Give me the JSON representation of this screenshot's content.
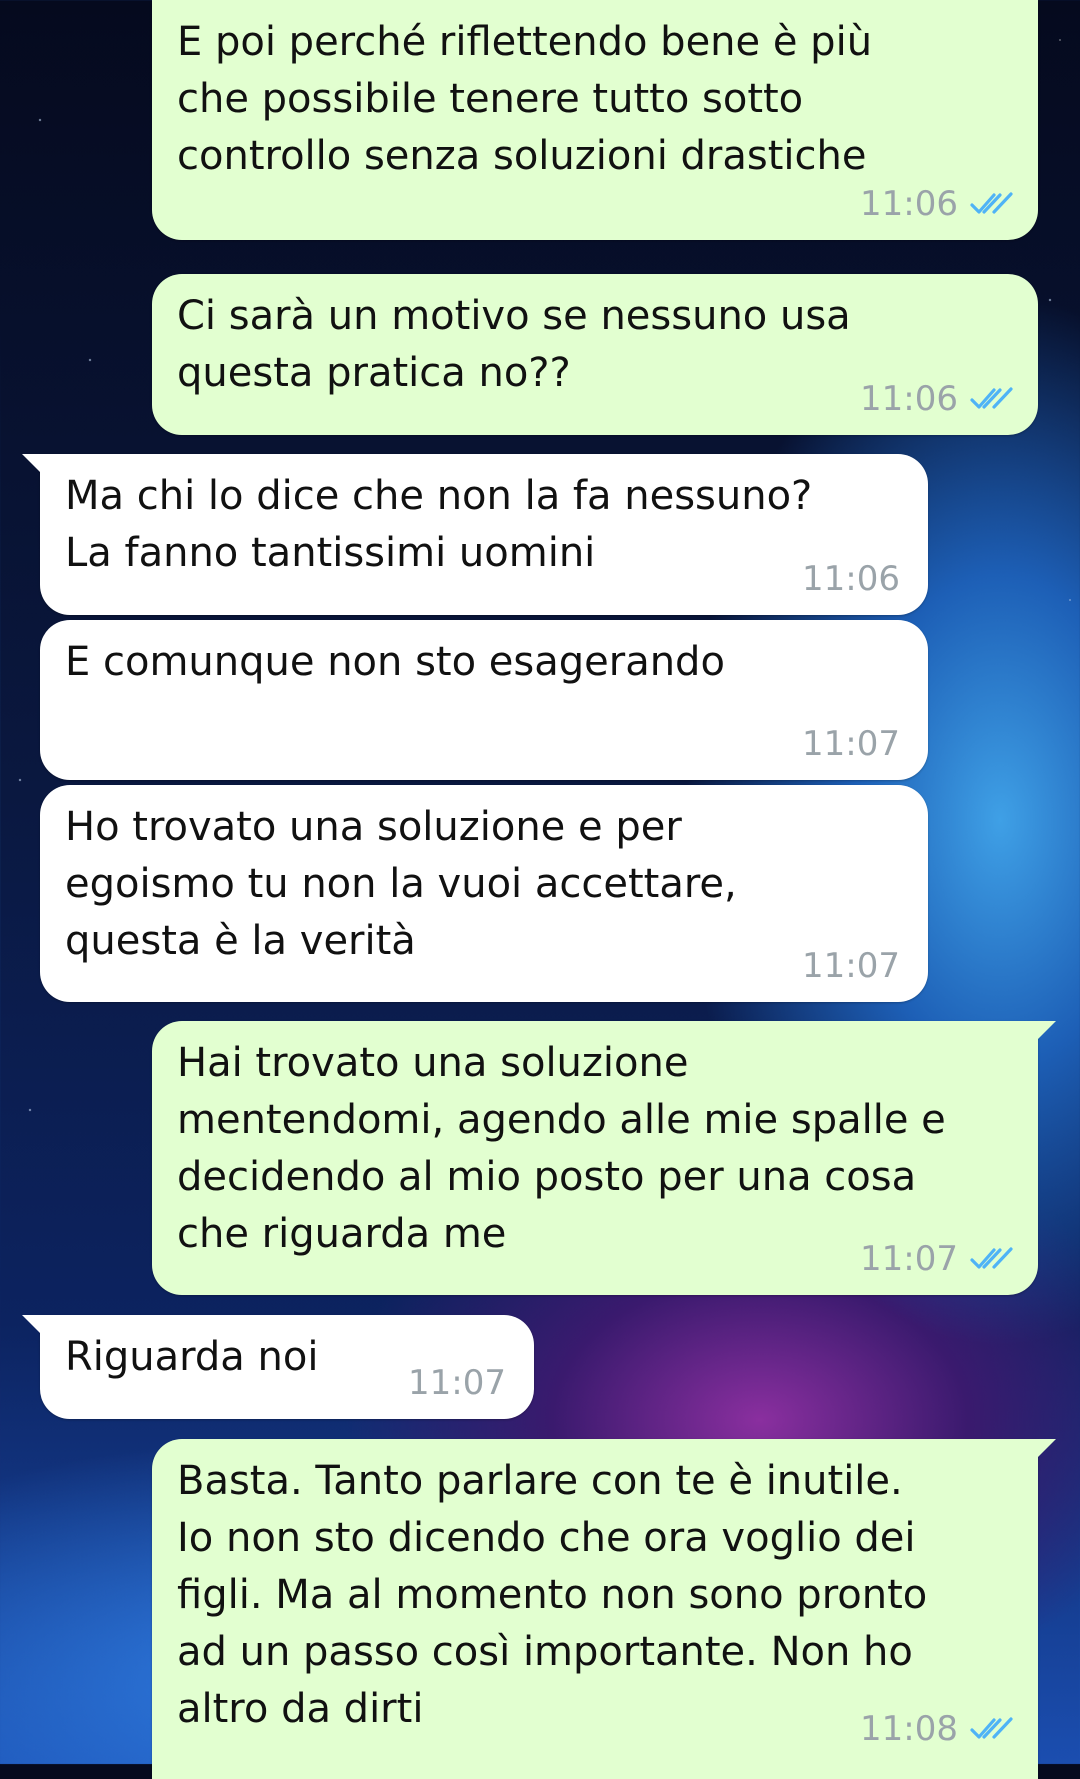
{
  "messages": [
    {
      "direction": "out",
      "text": "E poi perché riflettendo bene è più\nche possibile tenere tutto sotto\ncontrollo senza soluzioni drastiche",
      "time": "11:06",
      "status_icon": "double-check-read-icon",
      "tick_color": "#4fb3f6"
    },
    {
      "direction": "out",
      "text": "Ci sarà un motivo se nessuno usa\nquesta pratica no??",
      "time": "11:06",
      "status_icon": "double-check-read-icon",
      "tick_color": "#4fb3f6"
    },
    {
      "direction": "in",
      "text": "Ma chi lo dice che non la fa nessuno?\nLa fanno tantissimi uomini",
      "time": "11:06"
    },
    {
      "direction": "in",
      "text": "E comunque non sto esagerando",
      "time": "11:07"
    },
    {
      "direction": "in",
      "text": "Ho trovato una soluzione e per\negoismo tu non la vuoi accettare,\nquesta è la verità",
      "time": "11:07"
    },
    {
      "direction": "out",
      "text": "Hai trovato una soluzione\nmentendomi, agendo alle mie spalle e\ndecidendo al mio posto per una cosa\nche riguarda me",
      "time": "11:07",
      "status_icon": "double-check-read-icon",
      "tick_color": "#4fb3f6"
    },
    {
      "direction": "in",
      "text": "Riguarda noi",
      "time": "11:07"
    },
    {
      "direction": "out",
      "text": "Basta. Tanto parlare con te è inutile.\nIo non sto dicendo che ora voglio dei\nfigli. Ma al momento non sono pronto\nad un passo così importante. Non ho\naltro da dirti",
      "time": "11:08",
      "status_icon": "double-check-read-icon",
      "tick_color": "#4fb3f6"
    }
  ],
  "colors": {
    "outgoing_bubble": "#e2ffd0",
    "incoming_bubble": "#ffffff",
    "timestamp": "#9aa3a9",
    "read_ticks": "#4fb3f6"
  }
}
